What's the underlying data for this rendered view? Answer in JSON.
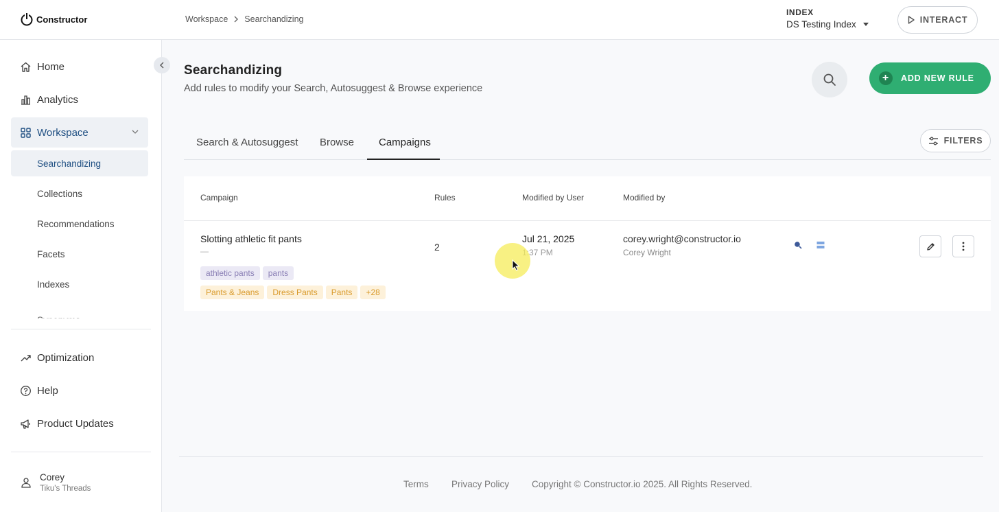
{
  "brand": {
    "name": "Constructor"
  },
  "breadcrumb": {
    "items": [
      "Workspace",
      "Searchandizing"
    ]
  },
  "index": {
    "label": "INDEX",
    "value": "DS Testing Index"
  },
  "header": {
    "interact_label": "INTERACT"
  },
  "sidebar": {
    "items": [
      {
        "label": "Home",
        "icon": "home-icon"
      },
      {
        "label": "Analytics",
        "icon": "bar-chart-icon"
      },
      {
        "label": "Workspace",
        "icon": "grid-icon",
        "expanded": true
      }
    ],
    "workspace_children": [
      "Searchandizing",
      "Collections",
      "Recommendations",
      "Facets",
      "Indexes",
      "Synonyms"
    ],
    "bottom_items": [
      {
        "label": "Optimization",
        "icon": "trend-up-icon"
      },
      {
        "label": "Help",
        "icon": "help-circle-icon"
      },
      {
        "label": "Product Updates",
        "icon": "megaphone-icon"
      }
    ],
    "user": {
      "name": "Corey",
      "org": "Tiku's Threads"
    }
  },
  "page": {
    "title": "Searchandizing",
    "subtitle": "Add rules to modify your Search, Autosuggest & Browse experience",
    "add_rule_label": "ADD NEW RULE",
    "filters_label": "FILTERS"
  },
  "tabs": [
    {
      "label": "Search & Autosuggest",
      "active": false
    },
    {
      "label": "Browse",
      "active": false
    },
    {
      "label": "Campaigns",
      "active": true
    }
  ],
  "table": {
    "columns": [
      "Campaign",
      "Rules",
      "Modified by User",
      "Modified by"
    ],
    "rows": [
      {
        "campaign": "Slotting athletic fit pants",
        "description": "—",
        "tags_purple": [
          "athletic pants",
          "pants"
        ],
        "tags_orange": [
          "Pants & Jeans",
          "Dress Pants",
          "Pants",
          "+28"
        ],
        "rules": "2",
        "date": "Jul 21, 2025",
        "time": "1:37 PM",
        "email": "corey.wright@constructor.io",
        "user": "Corey Wright"
      }
    ]
  },
  "footer": {
    "terms": "Terms",
    "privacy": "Privacy Policy",
    "copyright": "Copyright © Constructor.io 2025. All Rights Reserved."
  },
  "colors": {
    "accent_green": "#2fae72",
    "active_blue": "#1f4f82",
    "tag_purple": "#8a7fb5",
    "tag_orange": "#d99a2b"
  }
}
